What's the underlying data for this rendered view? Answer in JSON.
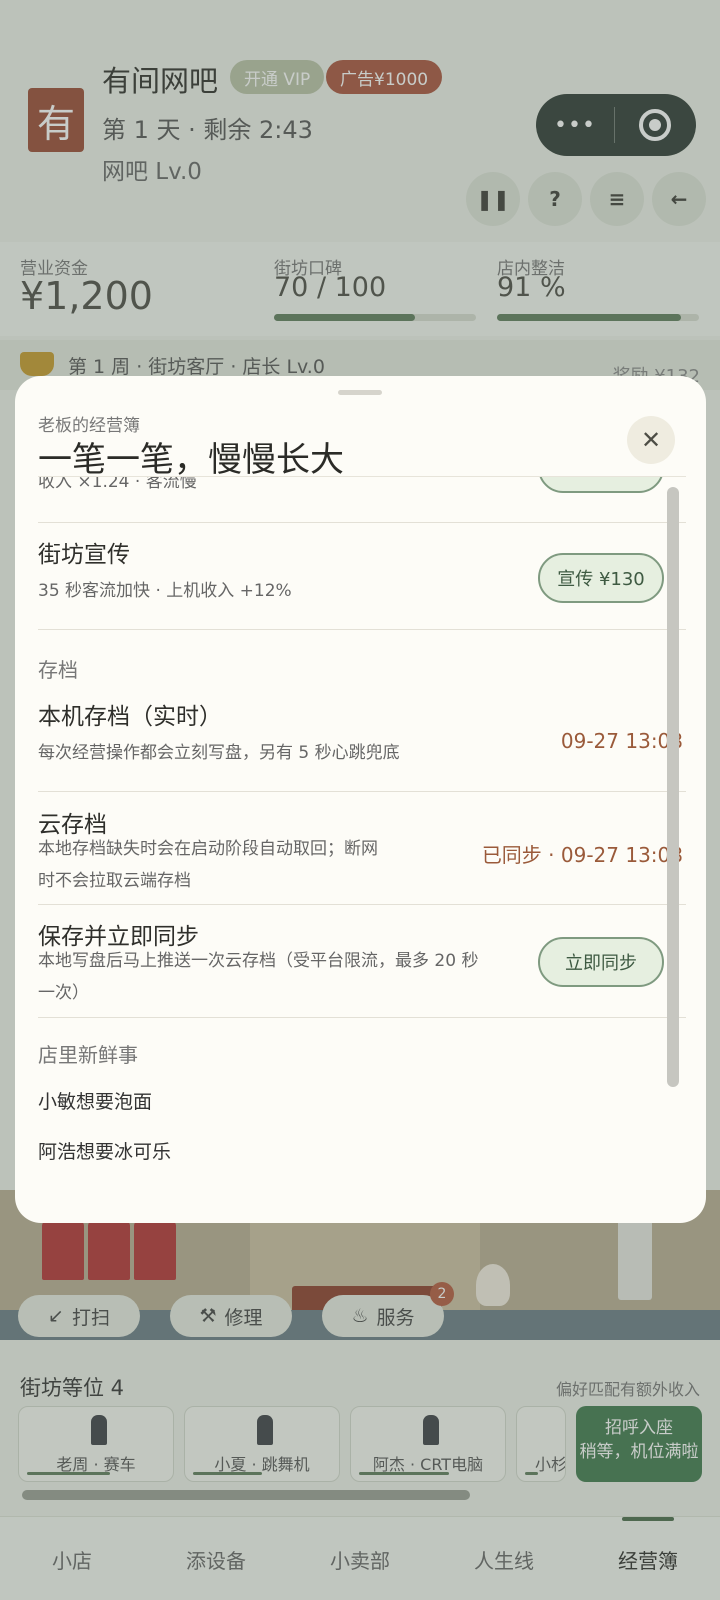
{
  "header": {
    "avatar_char": "有",
    "shop_name": "有间网吧",
    "vip_label": "开通 VIP",
    "ad_label": "广告¥1000",
    "day_info": "第 1 天 · 剩余 2:43",
    "level": "网吧 Lv.0",
    "capsule_dots": "•••",
    "buttons": {
      "pause": "❚❚",
      "help": "?",
      "settings": "≡",
      "back": "←"
    }
  },
  "stats": {
    "funds_label": "营业资金",
    "funds_value": "¥1,200",
    "reputation_label": "街坊口碑",
    "reputation_value": "70 / 100",
    "reputation_level": 0.7,
    "clean_label": "店内整洁",
    "clean_value": "91 %",
    "clean_level": 0.91
  },
  "week_banner": {
    "text": "第 1 周 · 街坊客厅 · 店长 Lv.0",
    "reward": "奖励 ¥132"
  },
  "modal": {
    "subtitle": "老板的经营簿",
    "title": "一笔一笔，慢慢长大",
    "close": "✕",
    "cut_row_desc": "收入 ×1.24 · 客流慢",
    "promo": {
      "title": "街坊宣传",
      "desc": "35 秒客流加快 · 上机收入 +12%",
      "button": "宣传 ¥130"
    },
    "save_section": "存档",
    "local_save": {
      "title": "本机存档（实时）",
      "desc": "每次经营操作都会立刻写盘，另有 5 秒心跳兜底",
      "value": "09-27 13:08"
    },
    "cloud_save": {
      "title": "云存档",
      "desc_line1": "本地存档缺失时会在启动阶段自动取回；断网",
      "desc_line2": "时不会拉取云端存档",
      "value": "已同步 · 09-27 13:08"
    },
    "sync_now": {
      "title": "保存并立即同步",
      "desc_line1": "本地写盘后马上推送一次云存档（受平台限流，最多 20 秒",
      "desc_line2": "一次）",
      "button": "立即同步"
    },
    "news_section": "店里新鲜事",
    "news": [
      "小敏想要泡面",
      "阿浩想要冰可乐"
    ]
  },
  "actions": {
    "sweep": "打扫",
    "repair": "修理",
    "service": "服务",
    "service_badge": "2"
  },
  "seats": {
    "title": "街坊等位 4",
    "hint": "偏好匹配有额外收入",
    "items": [
      {
        "name": "老周 · 赛车",
        "patience": 0.6
      },
      {
        "name": "小夏 · 跳舞机",
        "patience": 0.5
      },
      {
        "name": "阿杰 · CRT电脑",
        "patience": 0.65
      },
      {
        "name": "小杉",
        "patience": 0.4
      }
    ],
    "greet_title": "招呼入座",
    "greet_sub": "稍等，机位满啦"
  },
  "tabs": [
    "小店",
    "添设备",
    "小卖部",
    "人生线",
    "经营簿"
  ],
  "colors": {
    "accent_green": "#3f7a4c",
    "brand_red": "#9a4a34",
    "time_text": "#9a5a3a"
  }
}
